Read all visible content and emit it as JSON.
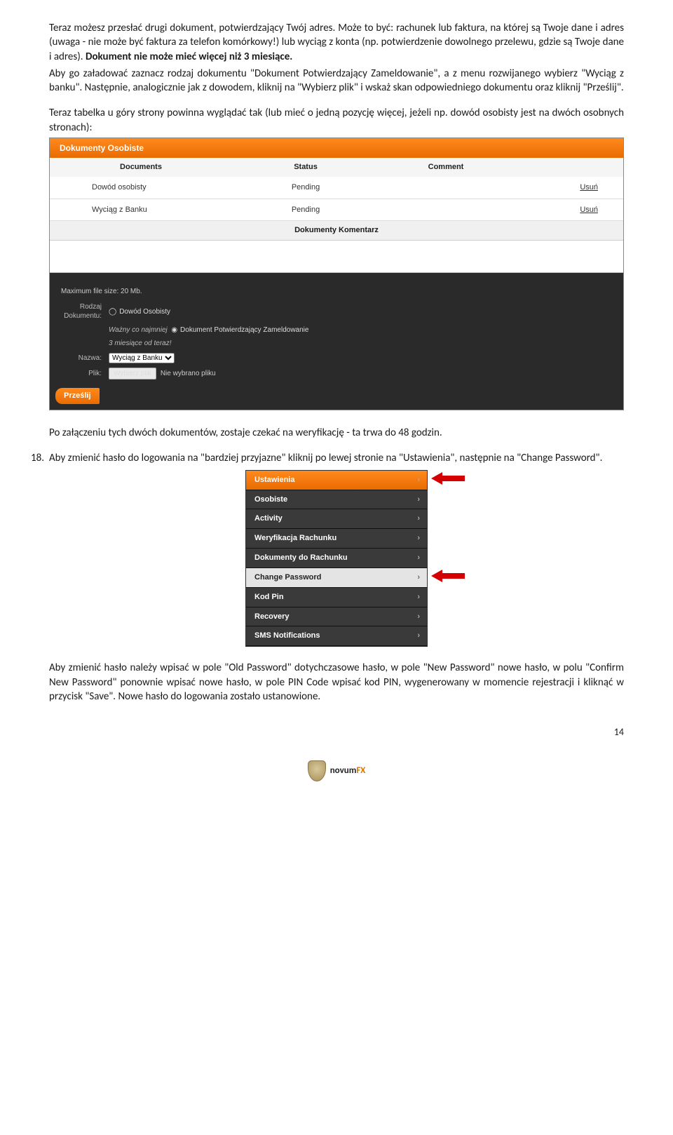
{
  "intro": {
    "p1a": "Teraz możesz przesłać drugi dokument, potwierdzający Twój adres. Może to być: rachunek lub faktura, na której są Twoje dane i adres (uwaga - nie może być faktura za telefon komórkowy!) lub wyciąg z konta (np. potwierdzenie dowolnego przelewu, gdzie są Twoje dane i adres). ",
    "p1b": "Dokument nie może mieć więcej niż 3 miesiące.",
    "p2": "Aby go załadować zaznacz rodzaj dokumentu \"Dokument Potwierdzający Zameldowanie\", a z menu rozwijanego wybierz \"Wyciąg z banku\". Następnie, analogicznie jak z dowodem, kliknij na \"Wybierz plik\" i wskaż skan odpowiedniego dokumentu oraz kliknij \"Prześlij\".",
    "p3": "Teraz tabelka u góry strony powinna wyglądać tak (lub mieć o jedną pozycję więcej, jeżeli np. dowód osobisty jest na dwóch osobnych stronach):"
  },
  "shot1": {
    "header": "Dokumenty Osobiste",
    "cols": {
      "c1": "Documents",
      "c2": "Status",
      "c3": "Comment"
    },
    "rows": [
      {
        "name": "Dowód osobisty",
        "status": "Pending",
        "action": "Usuń"
      },
      {
        "name": "Wyciąg z Banku",
        "status": "Pending",
        "action": "Usuń"
      }
    ],
    "komentarz_hdr": "Dokumenty Komentarz",
    "max_file": "Maximum file size: 20 Mb.",
    "rodzaj_lbl": "Rodzaj Dokumentu:",
    "radio1": "Dowód Osobisty",
    "radio2": "Dokument Potwierdzający Zameldowanie",
    "wazny": "Ważny co najmniej 3 miesiące od teraz!",
    "nazwa_lbl": "Nazwa:",
    "nazwa_val": "Wyciąg z Banku",
    "plik_lbl": "Plik:",
    "wybierz_btn": "Wybierz plik",
    "nie_wybrano": "Nie wybrano pliku",
    "submit": "Prześlij"
  },
  "after1": "Po załączeniu tych dwóch dokumentów, zostaje czekać na weryfikację - ta trwa do 48 godzin.",
  "item18": {
    "num": "18.",
    "text": "Aby zmienić hasło do logowania na \"bardziej przyjazne\" kliknij po lewej stronie na \"Ustawienia\", następnie na \"Change Password\"."
  },
  "shot2": {
    "items": [
      {
        "label": "Ustawienia",
        "kind": "top",
        "arrow": true
      },
      {
        "label": "Osobiste",
        "kind": "dark"
      },
      {
        "label": "Activity",
        "kind": "dark"
      },
      {
        "label": "Weryfikacja Rachunku",
        "kind": "dark"
      },
      {
        "label": "Dokumenty do Rachunku",
        "kind": "dark"
      },
      {
        "label": "Change Password",
        "kind": "sel",
        "arrow": true
      },
      {
        "label": "Kod Pin",
        "kind": "dark"
      },
      {
        "label": "Recovery",
        "kind": "dark"
      },
      {
        "label": "SMS Notifications",
        "kind": "dark"
      }
    ]
  },
  "after2": "Aby zmienić hasło należy wpisać w pole \"Old Password\" dotychczasowe hasło, w pole \"New Password\" nowe hasło, w polu \"Confirm New Password\" ponownie wpisać nowe hasło, w pole PIN Code wpisać kod PIN, wygenerowany w momencie rejestracji i kliknąć w przycisk \"Save\". Nowe hasło do logowania zostało ustanowione.",
  "page_num": "14",
  "footer_brand": {
    "a": "novum",
    "b": "FX"
  }
}
